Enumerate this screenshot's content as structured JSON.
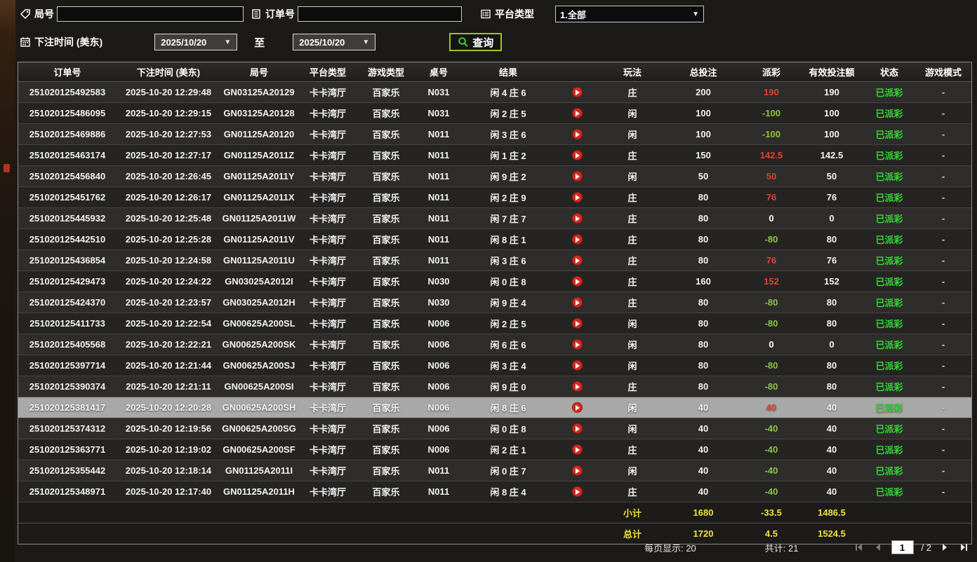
{
  "filters": {
    "game_no": {
      "label": "局号",
      "value": ""
    },
    "order_no": {
      "label": "订单号",
      "value": ""
    },
    "platform": {
      "label": "平台类型",
      "value": "1.全部"
    },
    "bet_time": {
      "label": "下注时间 (美东)"
    },
    "date_from": "2025/10/20",
    "to_label": "至",
    "date_to": "2025/10/20",
    "query_label": "查询"
  },
  "icons": {
    "game_no": "tag-icon",
    "order_no": "clipboard-icon",
    "platform": "list-icon",
    "bet_time": "calendar-icon",
    "query": "magnifier-icon",
    "row_media": "play-circle-icon",
    "pager": [
      "first-page-icon",
      "prev-page-icon",
      "next-page-icon",
      "last-page-icon"
    ]
  },
  "colors": {
    "accent_green_border": "#9fc41c",
    "win_red": "#e0422e",
    "loss_green": "#8ec63f",
    "status_green": "#35d435",
    "summary_yellow": "#f0e13a",
    "selected_row_bg": "#a8a8a8"
  },
  "table": {
    "headers": [
      "订单号",
      "下注时间 (美东)",
      "局号",
      "平台类型",
      "游戏类型",
      "桌号",
      "结果",
      "玩法",
      "总投注",
      "派彩",
      "有效投注额",
      "状态",
      "游戏模式"
    ],
    "rows": [
      {
        "order": "251020125492583",
        "time": "2025-10-20 12:29:48",
        "game_no": "GN03125A20129",
        "platform": "卡卡湾厅",
        "game_type": "百家乐",
        "table_no": "N031",
        "result": "闲 4 庄 6",
        "play": "庄",
        "total_bet": "200",
        "payout": "190",
        "payout_class": "win",
        "valid_bet": "190",
        "status": "已派彩",
        "mode": "-",
        "selected": false
      },
      {
        "order": "251020125486095",
        "time": "2025-10-20 12:29:15",
        "game_no": "GN03125A20128",
        "platform": "卡卡湾厅",
        "game_type": "百家乐",
        "table_no": "N031",
        "result": "闲 2 庄 5",
        "play": "闲",
        "total_bet": "100",
        "payout": "-100",
        "payout_class": "loss",
        "valid_bet": "100",
        "status": "已派彩",
        "mode": "-",
        "selected": false
      },
      {
        "order": "251020125469886",
        "time": "2025-10-20 12:27:53",
        "game_no": "GN01125A20120",
        "platform": "卡卡湾厅",
        "game_type": "百家乐",
        "table_no": "N011",
        "result": "闲 3 庄 6",
        "play": "闲",
        "total_bet": "100",
        "payout": "-100",
        "payout_class": "loss",
        "valid_bet": "100",
        "status": "已派彩",
        "mode": "-",
        "selected": false
      },
      {
        "order": "251020125463174",
        "time": "2025-10-20 12:27:17",
        "game_no": "GN01125A2011Z",
        "platform": "卡卡湾厅",
        "game_type": "百家乐",
        "table_no": "N011",
        "result": "闲 1 庄 2",
        "play": "庄",
        "total_bet": "150",
        "payout": "142.5",
        "payout_class": "win",
        "valid_bet": "142.5",
        "status": "已派彩",
        "mode": "-",
        "selected": false
      },
      {
        "order": "251020125456840",
        "time": "2025-10-20 12:26:45",
        "game_no": "GN01125A2011Y",
        "platform": "卡卡湾厅",
        "game_type": "百家乐",
        "table_no": "N011",
        "result": "闲 9 庄 2",
        "play": "闲",
        "total_bet": "50",
        "payout": "50",
        "payout_class": "win",
        "valid_bet": "50",
        "status": "已派彩",
        "mode": "-",
        "selected": false
      },
      {
        "order": "251020125451762",
        "time": "2025-10-20 12:26:17",
        "game_no": "GN01125A2011X",
        "platform": "卡卡湾厅",
        "game_type": "百家乐",
        "table_no": "N011",
        "result": "闲 2 庄 9",
        "play": "庄",
        "total_bet": "80",
        "payout": "76",
        "payout_class": "win",
        "valid_bet": "76",
        "status": "已派彩",
        "mode": "-",
        "selected": false
      },
      {
        "order": "251020125445932",
        "time": "2025-10-20 12:25:48",
        "game_no": "GN01125A2011W",
        "platform": "卡卡湾厅",
        "game_type": "百家乐",
        "table_no": "N011",
        "result": "闲 7 庄 7",
        "play": "庄",
        "total_bet": "80",
        "payout": "0",
        "payout_class": "zero",
        "valid_bet": "0",
        "status": "已派彩",
        "mode": "-",
        "selected": false
      },
      {
        "order": "251020125442510",
        "time": "2025-10-20 12:25:28",
        "game_no": "GN01125A2011V",
        "platform": "卡卡湾厅",
        "game_type": "百家乐",
        "table_no": "N011",
        "result": "闲 8 庄 1",
        "play": "庄",
        "total_bet": "80",
        "payout": "-80",
        "payout_class": "loss",
        "valid_bet": "80",
        "status": "已派彩",
        "mode": "-",
        "selected": false
      },
      {
        "order": "251020125436854",
        "time": "2025-10-20 12:24:58",
        "game_no": "GN01125A2011U",
        "platform": "卡卡湾厅",
        "game_type": "百家乐",
        "table_no": "N011",
        "result": "闲 3 庄 6",
        "play": "庄",
        "total_bet": "80",
        "payout": "76",
        "payout_class": "win",
        "valid_bet": "76",
        "status": "已派彩",
        "mode": "-",
        "selected": false
      },
      {
        "order": "251020125429473",
        "time": "2025-10-20 12:24:22",
        "game_no": "GN03025A2012I",
        "platform": "卡卡湾厅",
        "game_type": "百家乐",
        "table_no": "N030",
        "result": "闲 0 庄 8",
        "play": "庄",
        "total_bet": "160",
        "payout": "152",
        "payout_class": "win",
        "valid_bet": "152",
        "status": "已派彩",
        "mode": "-",
        "selected": false
      },
      {
        "order": "251020125424370",
        "time": "2025-10-20 12:23:57",
        "game_no": "GN03025A2012H",
        "platform": "卡卡湾厅",
        "game_type": "百家乐",
        "table_no": "N030",
        "result": "闲 9 庄 4",
        "play": "庄",
        "total_bet": "80",
        "payout": "-80",
        "payout_class": "loss",
        "valid_bet": "80",
        "status": "已派彩",
        "mode": "-",
        "selected": false
      },
      {
        "order": "251020125411733",
        "time": "2025-10-20 12:22:54",
        "game_no": "GN00625A200SL",
        "platform": "卡卡湾厅",
        "game_type": "百家乐",
        "table_no": "N006",
        "result": "闲 2 庄 5",
        "play": "闲",
        "total_bet": "80",
        "payout": "-80",
        "payout_class": "loss",
        "valid_bet": "80",
        "status": "已派彩",
        "mode": "-",
        "selected": false
      },
      {
        "order": "251020125405568",
        "time": "2025-10-20 12:22:21",
        "game_no": "GN00625A200SK",
        "platform": "卡卡湾厅",
        "game_type": "百家乐",
        "table_no": "N006",
        "result": "闲 6 庄 6",
        "play": "闲",
        "total_bet": "80",
        "payout": "0",
        "payout_class": "zero",
        "valid_bet": "0",
        "status": "已派彩",
        "mode": "-",
        "selected": false
      },
      {
        "order": "251020125397714",
        "time": "2025-10-20 12:21:44",
        "game_no": "GN00625A200SJ",
        "platform": "卡卡湾厅",
        "game_type": "百家乐",
        "table_no": "N006",
        "result": "闲 3 庄 4",
        "play": "闲",
        "total_bet": "80",
        "payout": "-80",
        "payout_class": "loss",
        "valid_bet": "80",
        "status": "已派彩",
        "mode": "-",
        "selected": false
      },
      {
        "order": "251020125390374",
        "time": "2025-10-20 12:21:11",
        "game_no": "GN00625A200SI",
        "platform": "卡卡湾厅",
        "game_type": "百家乐",
        "table_no": "N006",
        "result": "闲 9 庄 0",
        "play": "庄",
        "total_bet": "80",
        "payout": "-80",
        "payout_class": "loss",
        "valid_bet": "80",
        "status": "已派彩",
        "mode": "-",
        "selected": false
      },
      {
        "order": "251020125381417",
        "time": "2025-10-20 12:20:28",
        "game_no": "GN00625A200SH",
        "platform": "卡卡湾厅",
        "game_type": "百家乐",
        "table_no": "N006",
        "result": "闲 8 庄 6",
        "play": "闲",
        "total_bet": "40",
        "payout": "40",
        "payout_class": "win",
        "valid_bet": "40",
        "status": "已派彩",
        "mode": "-",
        "selected": true
      },
      {
        "order": "251020125374312",
        "time": "2025-10-20 12:19:56",
        "game_no": "GN00625A200SG",
        "platform": "卡卡湾厅",
        "game_type": "百家乐",
        "table_no": "N006",
        "result": "闲 0 庄 8",
        "play": "闲",
        "total_bet": "40",
        "payout": "-40",
        "payout_class": "loss",
        "valid_bet": "40",
        "status": "已派彩",
        "mode": "-",
        "selected": false
      },
      {
        "order": "251020125363771",
        "time": "2025-10-20 12:19:02",
        "game_no": "GN00625A200SF",
        "platform": "卡卡湾厅",
        "game_type": "百家乐",
        "table_no": "N006",
        "result": "闲 2 庄 1",
        "play": "庄",
        "total_bet": "40",
        "payout": "-40",
        "payout_class": "loss",
        "valid_bet": "40",
        "status": "已派彩",
        "mode": "-",
        "selected": false
      },
      {
        "order": "251020125355442",
        "time": "2025-10-20 12:18:14",
        "game_no": "GN01125A2011I",
        "platform": "卡卡湾厅",
        "game_type": "百家乐",
        "table_no": "N011",
        "result": "闲 0 庄 7",
        "play": "闲",
        "total_bet": "40",
        "payout": "-40",
        "payout_class": "loss",
        "valid_bet": "40",
        "status": "已派彩",
        "mode": "-",
        "selected": false
      },
      {
        "order": "251020125348971",
        "time": "2025-10-20 12:17:40",
        "game_no": "GN01125A2011H",
        "platform": "卡卡湾厅",
        "game_type": "百家乐",
        "table_no": "N011",
        "result": "闲 8 庄 4",
        "play": "庄",
        "total_bet": "40",
        "payout": "-40",
        "payout_class": "loss",
        "valid_bet": "40",
        "status": "已派彩",
        "mode": "-",
        "selected": false
      }
    ]
  },
  "summary": {
    "subtotal": {
      "label": "小计",
      "total_bet": "1680",
      "payout": "-33.5",
      "valid_bet": "1486.5"
    },
    "total": {
      "label": "总计",
      "total_bet": "1720",
      "payout": "4.5",
      "valid_bet": "1524.5"
    }
  },
  "footer": {
    "per_page_label": "每页显示:",
    "per_page_value": "20",
    "count_label": "共计:",
    "count_value": "21",
    "page": "1",
    "separator": "/",
    "total_pages": "2"
  }
}
